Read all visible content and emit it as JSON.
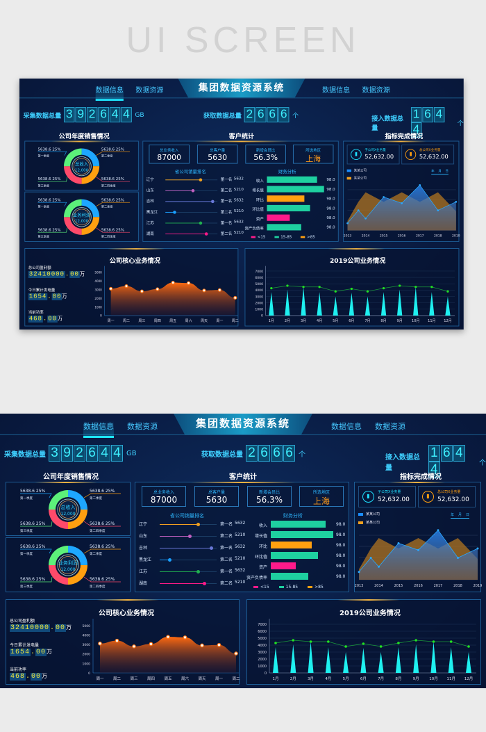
{
  "hero_title": "UI SCREEN",
  "header": {
    "title": "集团数据资源系统",
    "left_tabs": [
      {
        "label": "数据信息",
        "active": true
      },
      {
        "label": "数据资源",
        "active": false
      }
    ],
    "right_tabs": [
      {
        "label": "数据信息"
      },
      {
        "label": "数据资源"
      }
    ]
  },
  "counters": [
    {
      "label": "采集数据总量",
      "digits": [
        "3",
        "9",
        "2",
        "6",
        "4",
        "4"
      ],
      "unit": "GB"
    },
    {
      "label": "获取数据总量",
      "digits": [
        "2",
        "6",
        "6",
        "6"
      ],
      "unit": "个"
    },
    {
      "label": "接入数据总量",
      "digits": [
        "1",
        "6",
        "4",
        "4"
      ],
      "unit": "个"
    }
  ],
  "sales": {
    "title": "公司年度销售情况",
    "donuts": [
      {
        "center_label": "总收入",
        "center_value": "12,000",
        "items": [
          {
            "value": "5638.6  25%",
            "label": "第一季度",
            "color": "#1ea7ff"
          },
          {
            "value": "5638.6  25%",
            "label": "第二季度",
            "color": "#ff9f10"
          },
          {
            "value": "5638.6  25%",
            "label": "第三季度",
            "color": "#5cf07a"
          },
          {
            "value": "5638.6  25%",
            "label": "第二四季度",
            "color": "#ff4a6a"
          }
        ]
      },
      {
        "center_label": "业务利润",
        "center_value": "12,000",
        "items": [
          {
            "value": "5638.6  25%",
            "label": "第一季度",
            "color": "#1ea7ff"
          },
          {
            "value": "5638.6  25%",
            "label": "第二季度",
            "color": "#ff9f10"
          },
          {
            "value": "5638.6  25%",
            "label": "第三季度",
            "color": "#5cf07a"
          },
          {
            "value": "5638.6  25%",
            "label": "第二四季度",
            "color": "#ff4a6a"
          }
        ]
      }
    ]
  },
  "customers": {
    "title": "客户统计",
    "stats": [
      {
        "label": "总业务收入",
        "value": "87000",
        "color": "#ffffff"
      },
      {
        "label": "总客户量",
        "value": "5630",
        "color": "#ffffff"
      },
      {
        "label": "新增会员比",
        "value": "56.3%",
        "color": "#ffffff"
      },
      {
        "label": "所选地区",
        "value": "上海",
        "color": "#ff9a1a"
      }
    ],
    "ranking_title": "省公司销量排名",
    "ranking": [
      {
        "province": "辽宁",
        "rank": "第一名",
        "value": "5632",
        "fraction": 0.67,
        "color": "#f0a020"
      },
      {
        "province": "山东",
        "rank": "第二名",
        "value": "5210",
        "fraction": 0.52,
        "color": "#c060c0"
      },
      {
        "province": "吉林",
        "rank": "第一名",
        "value": "5632",
        "fraction": 0.9,
        "color": "#6a78d8"
      },
      {
        "province": "黑龙江",
        "rank": "第二名",
        "value": "5210",
        "fraction": 0.17,
        "color": "#1aa0ff"
      },
      {
        "province": "江苏",
        "rank": "第一名",
        "value": "5632",
        "fraction": 0.67,
        "color": "#20b050"
      },
      {
        "province": "湖南",
        "rank": "第二名",
        "value": "5210",
        "fraction": 0.78,
        "color": "#ff1a8a"
      }
    ],
    "finance_title": "财务分析",
    "finance": [
      {
        "label": "收入",
        "value": "98.0",
        "fraction": 0.88,
        "color": "#1ed0a0"
      },
      {
        "label": "增长值",
        "value": "98.0",
        "fraction": 1.0,
        "color": "#1ed0a0"
      },
      {
        "label": "环比",
        "value": "98.0",
        "fraction": 0.65,
        "color": "#ffa010"
      },
      {
        "label": "环比值",
        "value": "98.0",
        "fraction": 0.76,
        "color": "#1ed0a0"
      },
      {
        "label": "资产",
        "value": "98.0",
        "fraction": 0.4,
        "color": "#ff1a8a"
      },
      {
        "label": "资产负债率",
        "value": "98.0",
        "fraction": 0.6,
        "color": "#1ed0a0"
      }
    ],
    "legend": [
      {
        "label": "<15",
        "color": "#ff1a8a"
      },
      {
        "label": "15-85",
        "color": "#1ed0a0"
      },
      {
        "label": ">85",
        "color": "#ffa010"
      }
    ]
  },
  "indicators": {
    "title": "指标完成情况",
    "cards": [
      {
        "label": "子公司X业务量",
        "value": "52,632.00",
        "color": "#1ee0ff",
        "icon": "bar-chart-icon"
      },
      {
        "label": "总公司X业务量",
        "value": "52,632.00",
        "color": "#ffa010",
        "icon": "bar-chart-icon"
      }
    ],
    "legend": [
      {
        "label": "某某公司",
        "color": "#1a8cff"
      },
      {
        "label": "某某公司",
        "color": "#f0a020"
      }
    ],
    "period_tabs": [
      "年",
      "月",
      "日"
    ]
  },
  "core": {
    "title": "公司核心业务情况",
    "kpis": [
      {
        "label": "总公司盈利额",
        "int": "32410000",
        "dec": "00",
        "unit": "万"
      },
      {
        "label": "今日累计发电量",
        "int": "1654",
        "dec": "00",
        "unit": "万"
      },
      {
        "label": "当前功率",
        "int": "468",
        "dec": "00",
        "unit": "万"
      }
    ]
  },
  "chart_data": [
    {
      "type": "area",
      "title": "指标完成情况",
      "x_ticks": [
        "2013",
        "2014",
        "2015",
        "2016",
        "2017",
        "2018",
        "2019"
      ],
      "x": [
        2013,
        2013.6,
        2014,
        2015,
        2016,
        2017,
        2018,
        2019
      ],
      "series": [
        {
          "name": "某某公司",
          "color": "#1a8cff",
          "values": [
            15,
            42,
            25,
            70,
            57,
            95,
            42,
            60
          ]
        },
        {
          "name": "某某公司",
          "color": "#f0a020",
          "values": [
            20,
            60,
            80,
            60,
            80,
            60,
            80,
            40
          ]
        }
      ],
      "ylim": [
        0,
        100
      ],
      "grid": true
    },
    {
      "type": "area",
      "title": "公司核心业务情况",
      "categories": [
        "周一",
        "周二",
        "周三",
        "周四",
        "周五",
        "周六",
        "周天",
        "周一",
        "周二"
      ],
      "values": [
        3100,
        3400,
        2800,
        3050,
        3800,
        3750,
        2900,
        2950,
        2050
      ],
      "y_ticks": [
        0,
        1000,
        2000,
        3000,
        4000,
        5000
      ],
      "ylim": [
        0,
        5500
      ],
      "color": "#ff7a1a"
    },
    {
      "type": "bar",
      "title": "2019公司业务情况",
      "categories": [
        "1月",
        "2月",
        "3月",
        "4月",
        "5月",
        "6月",
        "7月",
        "8月",
        "9月",
        "10月",
        "11月",
        "12月"
      ],
      "series": [
        {
          "type": "bar",
          "color": "#1ef0f0",
          "values": [
            3700,
            4100,
            4500,
            3700,
            3000,
            3600,
            3000,
            3700,
            4100,
            4500,
            3700,
            3000
          ]
        },
        {
          "type": "line",
          "color": "#22e022",
          "values": [
            4300,
            4700,
            4500,
            4500,
            3800,
            4200,
            3800,
            4300,
            4700,
            4500,
            4500,
            3800
          ]
        }
      ],
      "y_ticks": [
        0,
        1000,
        2000,
        3000,
        4000,
        5000,
        6000,
        7000
      ],
      "ylim": [
        0,
        7500
      ],
      "grid": true
    }
  ]
}
